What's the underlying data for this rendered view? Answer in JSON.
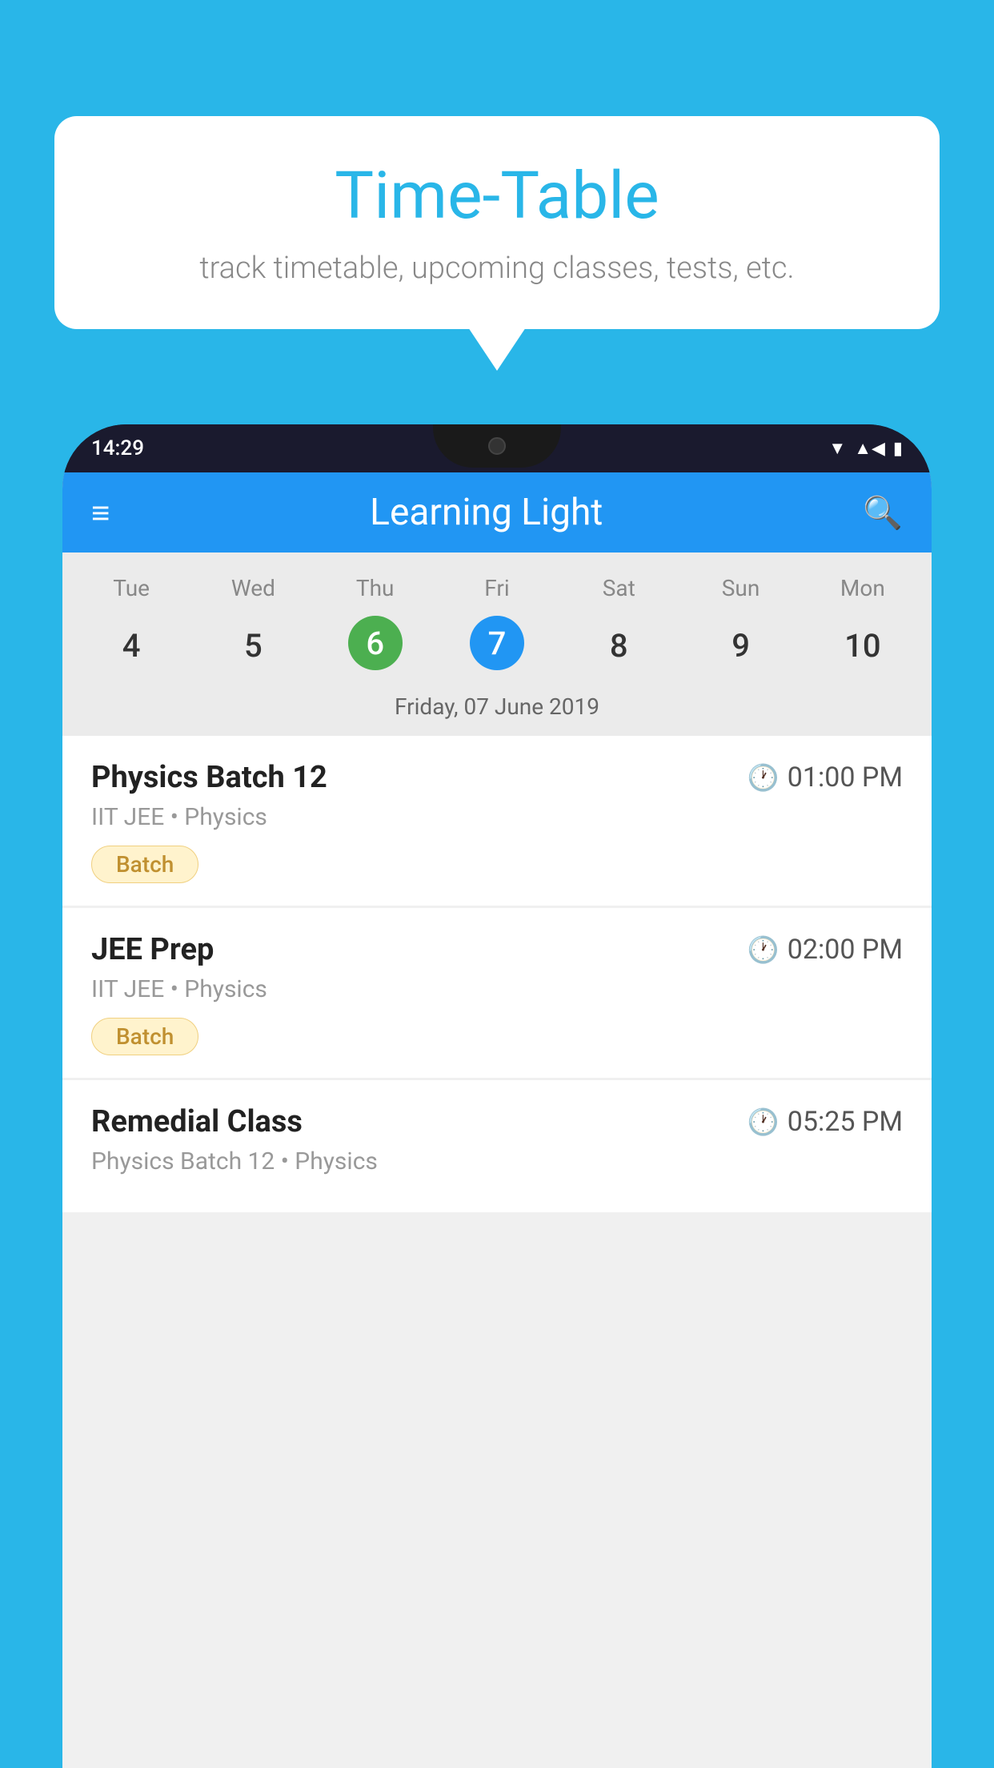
{
  "background_color": "#29b6e8",
  "bubble": {
    "title": "Time-Table",
    "subtitle": "track timetable, upcoming classes, tests, etc."
  },
  "phone": {
    "status_bar": {
      "time": "14:29"
    },
    "app_bar": {
      "title": "Learning Light"
    },
    "calendar": {
      "days": [
        "Tue",
        "Wed",
        "Thu",
        "Fri",
        "Sat",
        "Sun",
        "Mon"
      ],
      "dates": [
        "4",
        "5",
        "6",
        "7",
        "8",
        "9",
        "10"
      ],
      "today_index": 2,
      "selected_index": 3,
      "date_label": "Friday, 07 June 2019"
    },
    "schedule": [
      {
        "title": "Physics Batch 12",
        "time": "01:00 PM",
        "subtitle": "IIT JEE • Physics",
        "badge": "Batch"
      },
      {
        "title": "JEE Prep",
        "time": "02:00 PM",
        "subtitle": "IIT JEE • Physics",
        "badge": "Batch"
      },
      {
        "title": "Remedial Class",
        "time": "05:25 PM",
        "subtitle": "Physics Batch 12 • Physics",
        "badge": ""
      }
    ]
  },
  "icons": {
    "hamburger": "≡",
    "search": "🔍",
    "clock": "🕐"
  }
}
